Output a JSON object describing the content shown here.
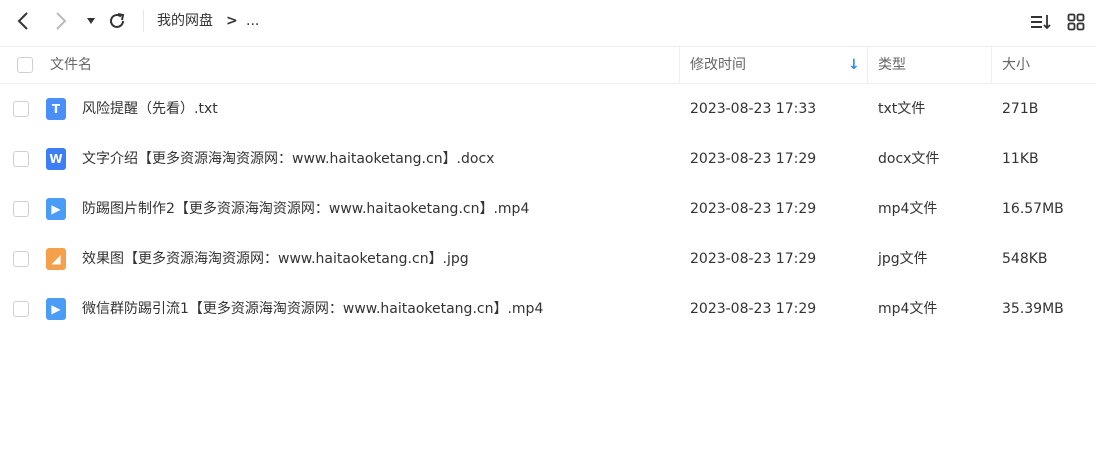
{
  "toolbar": {
    "back_icon": "chevron-left-icon",
    "forward_icon": "chevron-right-icon",
    "dropdown_icon": "caret-down-icon",
    "refresh_icon": "refresh-icon",
    "breadcrumb": {
      "root": "我的网盘",
      "separator": ">",
      "ellipsis": "..."
    },
    "sort_icon": "sort-list-icon",
    "grid_icon": "grid-view-icon"
  },
  "table": {
    "columns": {
      "name": "文件名",
      "modified": "修改时间",
      "type": "类型",
      "size": "大小"
    },
    "sort_indicator": "↓",
    "rows": [
      {
        "icon": "T",
        "icon_kind": "txt-file-icon",
        "icon_color": "#4a8ff7",
        "name": "风险提醒（先看）.txt",
        "modified": "2023-08-23 17:33",
        "type": "txt文件",
        "size": "271B"
      },
      {
        "icon": "W",
        "icon_kind": "word-file-icon",
        "icon_color": "#3d7ef5",
        "name": "文字介绍【更多资源海淘资源网：www.haitaoketang.cn】.docx",
        "modified": "2023-08-23 17:29",
        "type": "docx文件",
        "size": "11KB"
      },
      {
        "icon": "▶",
        "icon_kind": "video-file-icon",
        "icon_color": "#4a9cf7",
        "name": "防踢图片制作2【更多资源海淘资源网：www.haitaoketang.cn】.mp4",
        "modified": "2023-08-23 17:29",
        "type": "mp4文件",
        "size": "16.57MB"
      },
      {
        "icon": "◢",
        "icon_kind": "image-file-icon",
        "icon_color": "#f5a04a",
        "name": "效果图【更多资源海淘资源网：www.haitaoketang.cn】.jpg",
        "modified": "2023-08-23 17:29",
        "type": "jpg文件",
        "size": "548KB"
      },
      {
        "icon": "▶",
        "icon_kind": "video-file-icon",
        "icon_color": "#4a9cf7",
        "name": "微信群防踢引流1【更多资源海淘资源网：www.haitaoketang.cn】.mp4",
        "modified": "2023-08-23 17:29",
        "type": "mp4文件",
        "size": "35.39MB"
      }
    ]
  },
  "colors": {
    "accent": "#2b8cf0",
    "border": "#eeeeee",
    "text": "#333333",
    "muted": "#666666"
  }
}
